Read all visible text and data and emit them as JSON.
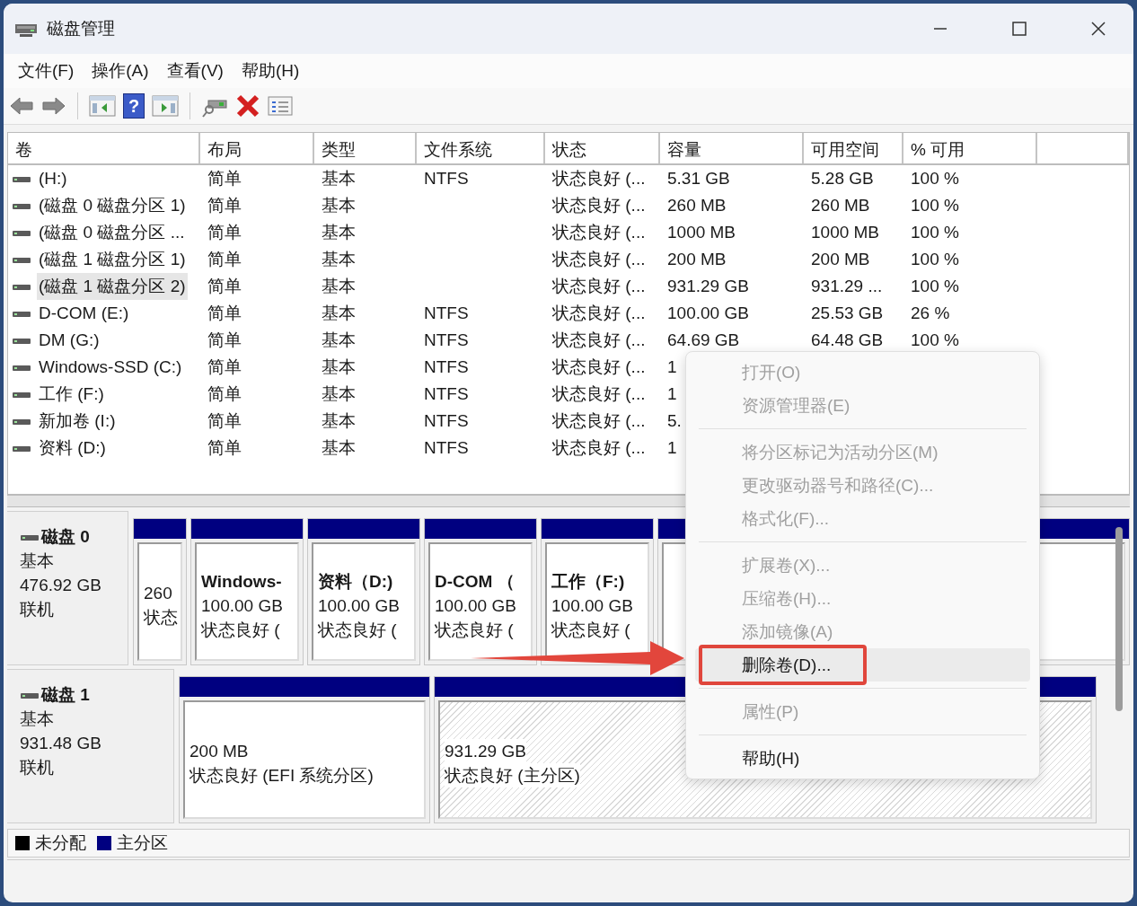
{
  "window": {
    "title": "磁盘管理"
  },
  "menu_bar": [
    "文件(F)",
    "操作(A)",
    "查看(V)",
    "帮助(H)"
  ],
  "toolbar": [
    {
      "kind": "back"
    },
    {
      "kind": "forward"
    },
    {
      "kind": "separator"
    },
    {
      "kind": "tree"
    },
    {
      "kind": "help",
      "label": "?"
    },
    {
      "kind": "panel"
    },
    {
      "kind": "separator"
    },
    {
      "kind": "rescan"
    },
    {
      "kind": "delete"
    },
    {
      "kind": "properties"
    }
  ],
  "volume_table": {
    "columns": [
      "卷",
      "布局",
      "类型",
      "文件系统",
      "状态",
      "容量",
      "可用空间",
      "% 可用"
    ],
    "rows": [
      {
        "selected": false,
        "cells": [
          "(H:)",
          "简单",
          "基本",
          "NTFS",
          "状态良好 (...",
          "5.31 GB",
          "5.28 GB",
          "100 %"
        ]
      },
      {
        "selected": false,
        "cells": [
          "(磁盘 0 磁盘分区 1)",
          "简单",
          "基本",
          "",
          "状态良好 (...",
          "260 MB",
          "260 MB",
          "100 %"
        ]
      },
      {
        "selected": false,
        "cells": [
          "(磁盘 0 磁盘分区 ...",
          "简单",
          "基本",
          "",
          "状态良好 (...",
          "1000 MB",
          "1000 MB",
          "100 %"
        ]
      },
      {
        "selected": false,
        "cells": [
          "(磁盘 1 磁盘分区 1)",
          "简单",
          "基本",
          "",
          "状态良好 (...",
          "200 MB",
          "200 MB",
          "100 %"
        ]
      },
      {
        "selected": true,
        "cells": [
          "(磁盘 1 磁盘分区 2)",
          "简单",
          "基本",
          "",
          "状态良好 (...",
          "931.29 GB",
          "931.29 ...",
          "100 %"
        ]
      },
      {
        "selected": false,
        "cells": [
          "D-COM (E:)",
          "简单",
          "基本",
          "NTFS",
          "状态良好 (...",
          "100.00 GB",
          "25.53 GB",
          "26 %"
        ]
      },
      {
        "selected": false,
        "cells": [
          "DM (G:)",
          "简单",
          "基本",
          "NTFS",
          "状态良好 (...",
          "64.69 GB",
          "64.48 GB",
          "100 %"
        ]
      },
      {
        "selected": false,
        "cells": [
          "Windows-SSD (C:)",
          "简单",
          "基本",
          "NTFS",
          "状态良好 (...",
          "1"
        ]
      },
      {
        "selected": false,
        "cells": [
          "工作 (F:)",
          "简单",
          "基本",
          "NTFS",
          "状态良好 (...",
          "1"
        ]
      },
      {
        "selected": false,
        "cells": [
          "新加卷 (I:)",
          "简单",
          "基本",
          "NTFS",
          "状态良好 (...",
          "5."
        ]
      },
      {
        "selected": false,
        "cells": [
          "资料 (D:)",
          "简单",
          "基本",
          "NTFS",
          "状态良好 (...",
          "1"
        ]
      }
    ]
  },
  "disks": [
    {
      "name": "磁盘 0",
      "type": "基本",
      "size": "476.92 GB",
      "status": "联机",
      "partitions": [
        {
          "selected": false,
          "size": "260",
          "status": "状态"
        },
        {
          "selected": false,
          "title": "Windows-",
          "size": "100.00 GB",
          "status": "状态良好 ("
        },
        {
          "selected": false,
          "title": "资料（D:)",
          "size": "100.00 GB",
          "status": "状态良好 ("
        },
        {
          "selected": false,
          "title": "D-COM （",
          "size": "100.00 GB",
          "status": "状态良好 ("
        },
        {
          "selected": false,
          "title": "工作（F:)",
          "size": "100.00 GB",
          "status": "状态良好 ("
        },
        {
          "selected": false
        }
      ]
    },
    {
      "name": "磁盘 1",
      "type": "基本",
      "size": "931.48 GB",
      "status": "联机",
      "partitions": [
        {
          "selected": false,
          "size": "200 MB",
          "status": "状态良好 (EFI 系统分区)"
        },
        {
          "selected": true,
          "size": "931.29 GB",
          "status": "状态良好 (主分区)"
        }
      ]
    }
  ],
  "legend": [
    {
      "label": "未分配",
      "color": "#000000"
    },
    {
      "label": "主分区",
      "color": "#000080"
    }
  ],
  "context_menu": {
    "items": [
      {
        "kind": "item",
        "label": "打开(O)",
        "disabled": true,
        "highlighted": false,
        "marked": false
      },
      {
        "kind": "item",
        "label": "资源管理器(E)",
        "disabled": true,
        "highlighted": false,
        "marked": false
      },
      {
        "kind": "separator"
      },
      {
        "kind": "item",
        "label": "将分区标记为活动分区(M)",
        "disabled": true,
        "highlighted": false,
        "marked": false
      },
      {
        "kind": "item",
        "label": "更改驱动器号和路径(C)...",
        "disabled": true,
        "highlighted": false,
        "marked": false
      },
      {
        "kind": "item",
        "label": "格式化(F)...",
        "disabled": true,
        "highlighted": false,
        "marked": false
      },
      {
        "kind": "separator"
      },
      {
        "kind": "item",
        "label": "扩展卷(X)...",
        "disabled": true,
        "highlighted": false,
        "marked": false
      },
      {
        "kind": "item",
        "label": "压缩卷(H)...",
        "disabled": true,
        "highlighted": false,
        "marked": false
      },
      {
        "kind": "item",
        "label": "添加镜像(A)",
        "disabled": true,
        "highlighted": false,
        "marked": false
      },
      {
        "kind": "item",
        "label": "删除卷(D)...",
        "disabled": false,
        "highlighted": true,
        "marked": true
      },
      {
        "kind": "separator"
      },
      {
        "kind": "item",
        "label": "属性(P)",
        "disabled": true,
        "highlighted": false,
        "marked": false
      },
      {
        "kind": "separator"
      },
      {
        "kind": "item",
        "label": "帮助(H)",
        "disabled": false,
        "highlighted": false,
        "marked": false
      }
    ]
  },
  "annotations": [
    {
      "kind": "arrow"
    }
  ]
}
